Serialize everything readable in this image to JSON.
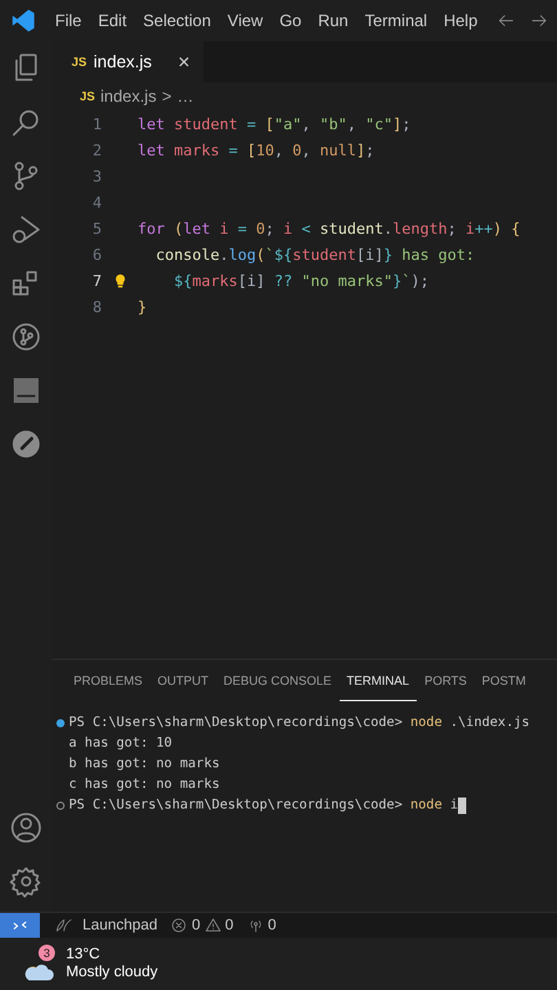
{
  "menu_bar": {
    "items": [
      "File",
      "Edit",
      "Selection",
      "View",
      "Go",
      "Run",
      "Terminal",
      "Help"
    ]
  },
  "editor": {
    "tabs": [
      {
        "badge": "JS",
        "label": "index.js",
        "close": "×",
        "selected": true
      }
    ],
    "breadcrumb": {
      "badge": "JS",
      "file": "index.js",
      "separator": ">",
      "rest": "…"
    },
    "lines": [
      {
        "number": "1",
        "current": false,
        "tokens": [
          {
            "kind": "keyword",
            "text": "let "
          },
          {
            "kind": "variable",
            "text": "student"
          },
          {
            "kind": "operator",
            "text": " = "
          },
          {
            "kind": "bracket",
            "text": "["
          },
          {
            "kind": "string",
            "text": "\"a\""
          },
          {
            "kind": "punct",
            "text": ", "
          },
          {
            "kind": "string",
            "text": "\"b\""
          },
          {
            "kind": "punct",
            "text": ", "
          },
          {
            "kind": "string",
            "text": "\"c\""
          },
          {
            "kind": "bracket",
            "text": "]"
          },
          {
            "kind": "punct",
            "text": ";"
          }
        ]
      },
      {
        "number": "2",
        "current": false,
        "tokens": [
          {
            "kind": "keyword",
            "text": "let "
          },
          {
            "kind": "variable",
            "text": "marks"
          },
          {
            "kind": "operator",
            "text": " = "
          },
          {
            "kind": "bracket",
            "text": "["
          },
          {
            "kind": "number",
            "text": "10"
          },
          {
            "kind": "punct",
            "text": ", "
          },
          {
            "kind": "number",
            "text": "0"
          },
          {
            "kind": "punct",
            "text": ", "
          },
          {
            "kind": "number",
            "text": "null"
          },
          {
            "kind": "bracket",
            "text": "]"
          },
          {
            "kind": "punct",
            "text": ";"
          }
        ]
      },
      {
        "number": "3",
        "current": false
      },
      {
        "number": "4",
        "current": false
      },
      {
        "number": "5",
        "current": false,
        "tokens": [
          {
            "kind": "keyword",
            "text": "for "
          },
          {
            "kind": "bracket",
            "text": "("
          },
          {
            "kind": "keyword",
            "text": "let"
          },
          {
            "kind": "variable",
            "text": " i"
          },
          {
            "kind": "operator",
            "text": " = "
          },
          {
            "kind": "number",
            "text": "0"
          },
          {
            "kind": "punct",
            "text": "; "
          },
          {
            "kind": "variable",
            "text": "i"
          },
          {
            "kind": "operator",
            "text": " < "
          },
          {
            "kind": "plain",
            "text": "student"
          },
          {
            "kind": "punct",
            "text": "."
          },
          {
            "kind": "variable",
            "text": "length"
          },
          {
            "kind": "punct",
            "text": "; "
          },
          {
            "kind": "variable",
            "text": "i"
          },
          {
            "kind": "operator",
            "text": "++"
          },
          {
            "kind": "bracket",
            "text": ")"
          },
          {
            "kind": "bracket",
            "text": " {"
          }
        ]
      },
      {
        "number": "6",
        "current": false,
        "tokens": [
          {
            "kind": "plain",
            "text": "  console"
          },
          {
            "kind": "punct",
            "text": "."
          },
          {
            "kind": "function",
            "text": "log"
          },
          {
            "kind": "bracket",
            "text": "("
          },
          {
            "kind": "string",
            "text": "`"
          },
          {
            "kind": "operator",
            "text": "${"
          },
          {
            "kind": "variable",
            "text": "student"
          },
          {
            "kind": "punct",
            "text": "[i]"
          },
          {
            "kind": "operator",
            "text": "}"
          },
          {
            "kind": "string",
            "text": " has got:"
          }
        ]
      },
      {
        "number": "7",
        "current": true,
        "lightbulb": true,
        "tokens": [
          {
            "kind": "operator",
            "text": "    ${"
          },
          {
            "kind": "variable",
            "text": "marks"
          },
          {
            "kind": "punct",
            "text": "[i]"
          },
          {
            "kind": "operator",
            "text": " ?? "
          },
          {
            "kind": "string",
            "text": "\"no marks\""
          },
          {
            "kind": "operator",
            "text": "}"
          },
          {
            "kind": "string",
            "text": "`"
          },
          {
            "kind": "punct",
            "text": ");"
          }
        ]
      },
      {
        "number": "8",
        "current": false,
        "tokens": [
          {
            "kind": "bracket",
            "text": "}"
          }
        ]
      }
    ]
  },
  "panel": {
    "tabs": [
      {
        "label": "PROBLEMS",
        "selected": false
      },
      {
        "label": "OUTPUT",
        "selected": false
      },
      {
        "label": "DEBUG CONSOLE",
        "selected": false
      },
      {
        "label": "TERMINAL",
        "selected": true
      },
      {
        "label": "PORTS",
        "selected": false
      },
      {
        "label": "POSTM",
        "selected": false
      }
    ],
    "terminal": [
      {
        "kind": "prompt",
        "succeeded": true,
        "path": "PS C:\\Users\\sharm\\Desktop\\recordings\\code>",
        "command": "node",
        "args": ".\\index.js",
        "cursor": false
      },
      {
        "kind": "output",
        "text": "a has got: 10"
      },
      {
        "kind": "output",
        "text": "b has got: no marks"
      },
      {
        "kind": "output",
        "text": "c has got: no marks"
      },
      {
        "kind": "prompt",
        "succeeded": false,
        "path": "PS C:\\Users\\sharm\\Desktop\\recordings\\code>",
        "command": "node",
        "args": "i",
        "cursor": true
      }
    ]
  },
  "status_bar": {
    "launchpad": "Launchpad",
    "errors": "0",
    "warnings": "0",
    "ports": "0"
  },
  "taskbar": {
    "weather": {
      "badge": "3",
      "temperature": "13°C",
      "condition": "Mostly cloudy"
    }
  }
}
